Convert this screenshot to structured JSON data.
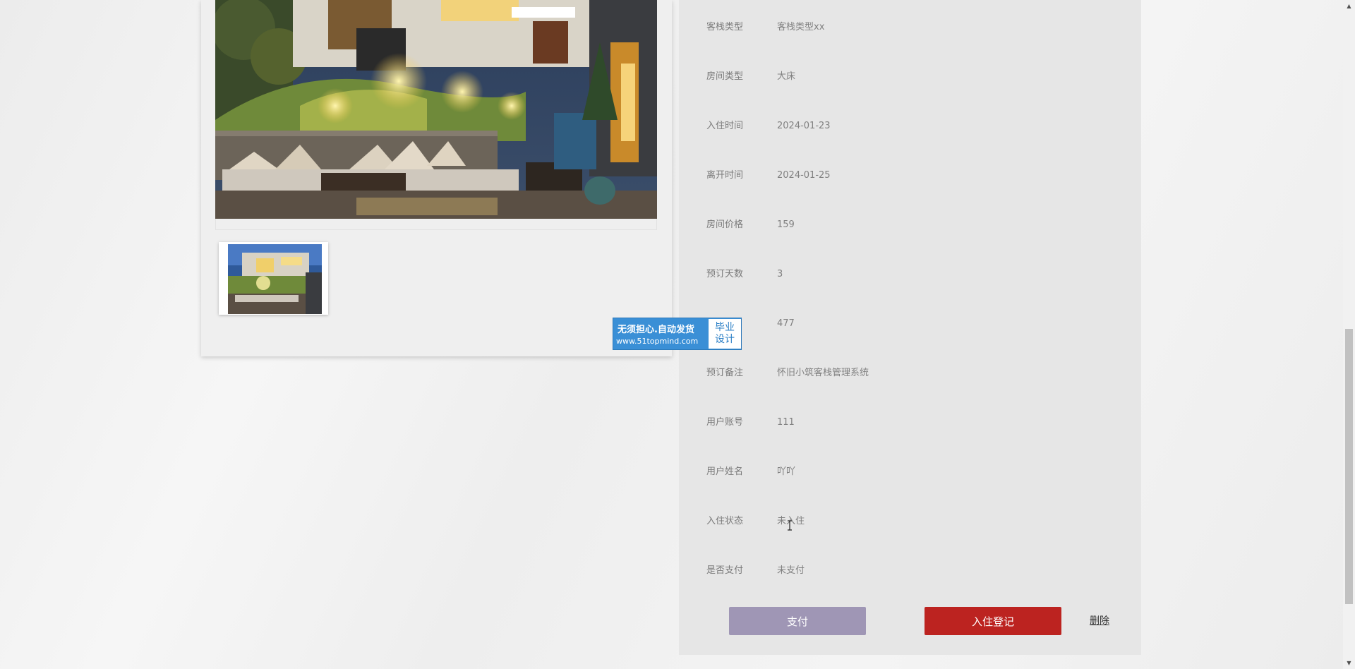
{
  "details": [
    {
      "label": "客栈类型",
      "value": "客栈类型xx"
    },
    {
      "label": "房间类型",
      "value": "大床"
    },
    {
      "label": "入住时间",
      "value": "2024-01-23"
    },
    {
      "label": "离开时间",
      "value": "2024-01-25"
    },
    {
      "label": "房间价格",
      "value": "159"
    },
    {
      "label": "预订天数",
      "value": "3"
    },
    {
      "label": "",
      "value": "477"
    },
    {
      "label": "预订备注",
      "value": "怀旧小筑客栈管理系统"
    },
    {
      "label": "用户账号",
      "value": "111"
    },
    {
      "label": "用户姓名",
      "value": "吖吖"
    },
    {
      "label": "入住状态",
      "value": "未入住"
    },
    {
      "label": "是否支付",
      "value": "未支付"
    }
  ],
  "actions": {
    "pay_label": "支付",
    "checkin_label": "入住登记",
    "delete_label": "删除"
  },
  "watermark": {
    "line1": "无须担心.自动发货",
    "line2": "www.51topmind.com",
    "badge_line1": "毕业",
    "badge_line2": "设计"
  },
  "colors": {
    "pay_button": "#9f96b5",
    "checkin_button": "#bc2320",
    "panel_bg": "#e6e6e6",
    "watermark_bg": "#3a8fd6"
  },
  "icons": {
    "scroll_up": "scroll-up-arrow-icon",
    "scroll_down": "scroll-down-arrow-icon",
    "cursor": "text-cursor-icon"
  }
}
